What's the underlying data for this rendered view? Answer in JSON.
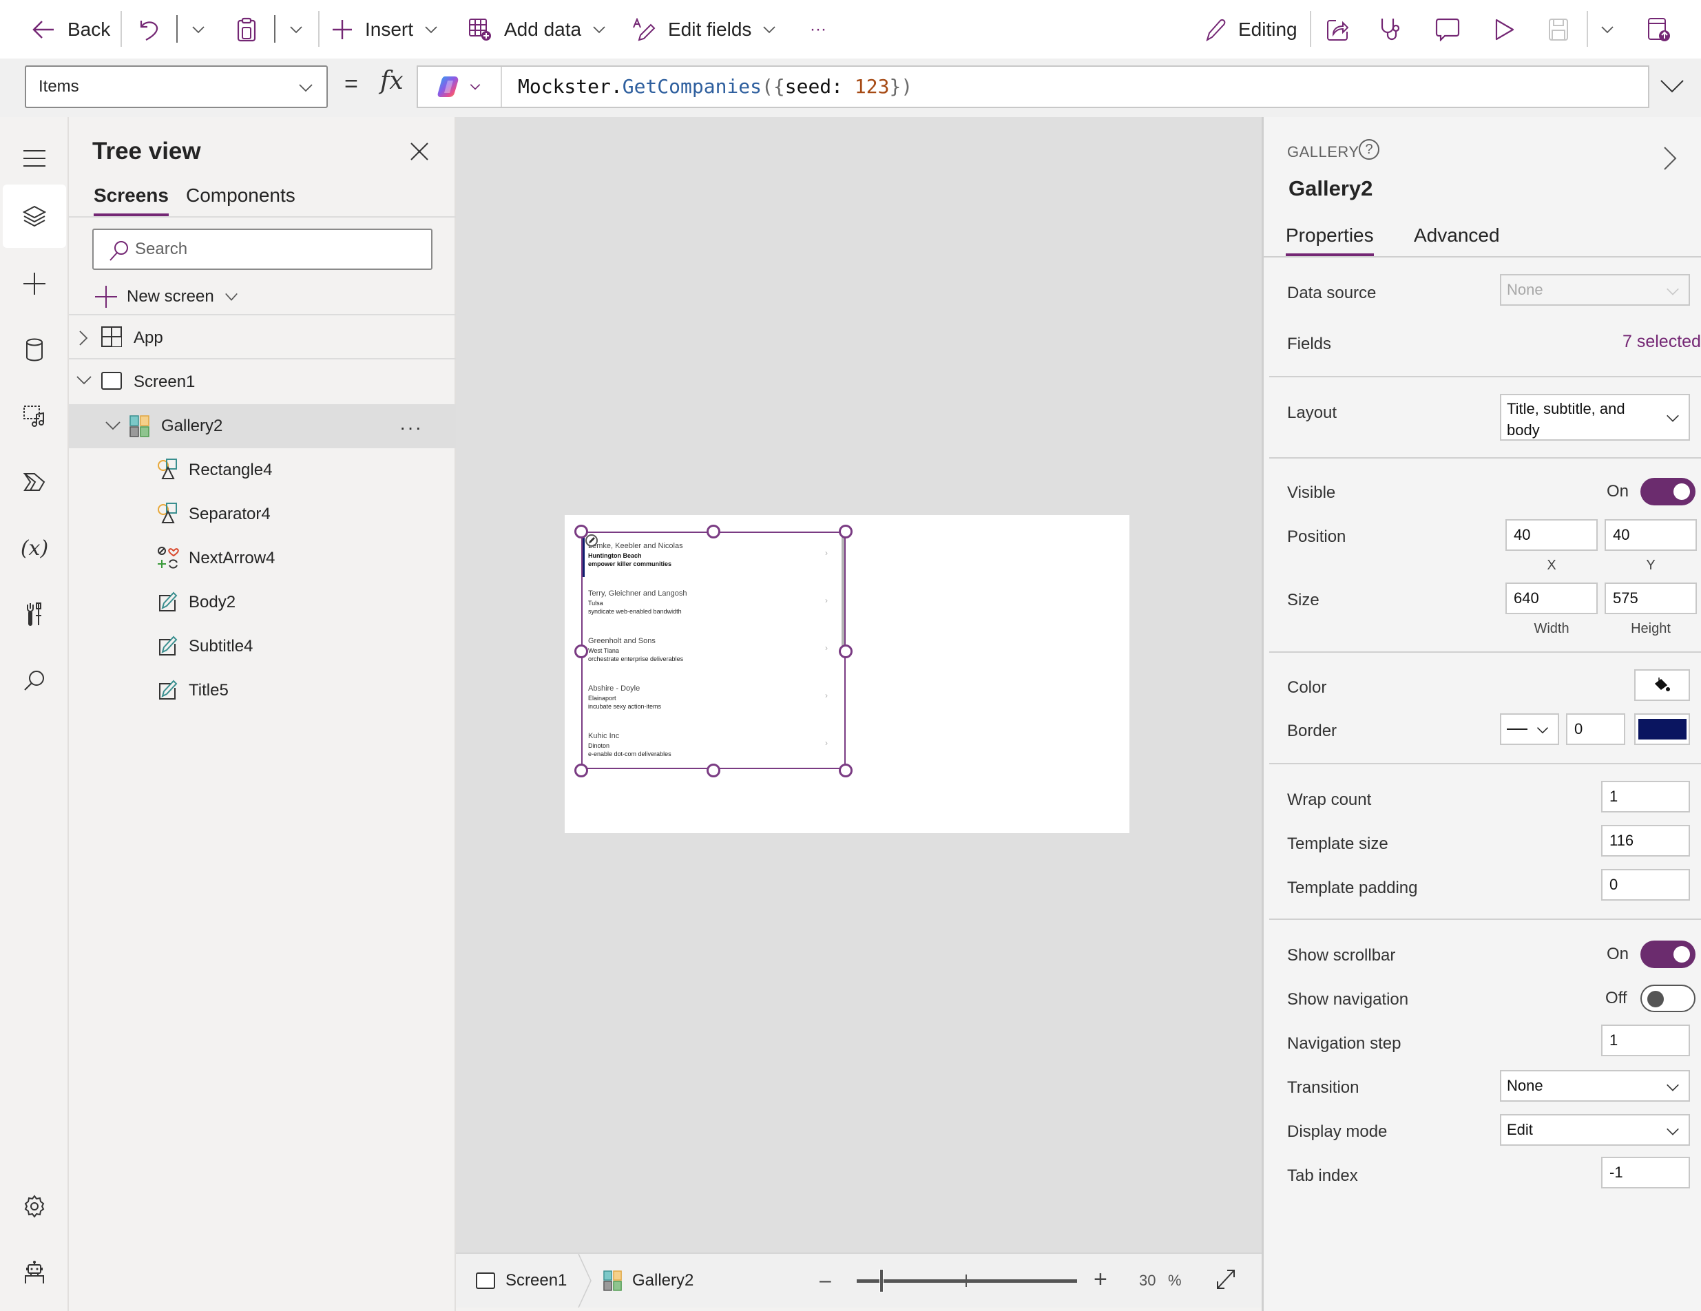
{
  "toolbar": {
    "back_label": "Back",
    "insert_label": "Insert",
    "add_data_label": "Add data",
    "edit_fields_label": "Edit fields",
    "more_label": "···",
    "mode_label": "Editing"
  },
  "formula_bar": {
    "property": "Items",
    "equals": "=",
    "fx": "fx",
    "formula": {
      "object": "Mockster.",
      "function": "GetCompanies",
      "open": "({",
      "key": "seed: ",
      "number": "123",
      "close": "})"
    }
  },
  "tree_view": {
    "title": "Tree view",
    "tabs": [
      {
        "label": "Screens",
        "active": true
      },
      {
        "label": "Components",
        "active": false
      }
    ],
    "search_placeholder": "Search",
    "new_screen_label": "New screen",
    "nodes": [
      {
        "label": "App",
        "icon": "app-icon",
        "expanded": false
      },
      {
        "label": "Screen1",
        "icon": "screen-icon",
        "expanded": true
      },
      {
        "label": "Gallery2",
        "icon": "gallery-icon",
        "expanded": true,
        "selected": true
      },
      {
        "label": "Rectangle4",
        "icon": "shapes-icon"
      },
      {
        "label": "Separator4",
        "icon": "shapes-icon"
      },
      {
        "label": "NextArrow4",
        "icon": "icons-control-icon"
      },
      {
        "label": "Body2",
        "icon": "label-edit-icon"
      },
      {
        "label": "Subtitle4",
        "icon": "label-edit-icon"
      },
      {
        "label": "Title5",
        "icon": "label-edit-icon"
      }
    ],
    "more_label": "···"
  },
  "gallery_items": [
    {
      "title": "Lemke, Keebler and Nicolas",
      "subtitle": "Huntington Beach",
      "body": "empower killer communities"
    },
    {
      "title": "Terry, Gleichner and Langosh",
      "subtitle": "Tulsa",
      "body": "syndicate web-enabled bandwidth"
    },
    {
      "title": "Greenholt and Sons",
      "subtitle": "West Tiana",
      "body": "orchestrate enterprise deliverables"
    },
    {
      "title": "Abshire - Doyle",
      "subtitle": "Elainaport",
      "body": "incubate sexy action-items"
    },
    {
      "title": "Kuhic Inc",
      "subtitle": "Dinoton",
      "body": "e-enable dot-com deliverables"
    }
  ],
  "status_bar": {
    "breadcrumb": [
      {
        "label": "Screen1",
        "icon": "screen-icon"
      },
      {
        "label": "Gallery2",
        "icon": "gallery-icon"
      }
    ],
    "zoom_value": "30",
    "zoom_unit": "%",
    "zoom_percent": 30
  },
  "properties": {
    "control_type": "GALLERY",
    "control_name": "Gallery2",
    "tabs": [
      {
        "label": "Properties",
        "active": true
      },
      {
        "label": "Advanced",
        "active": false
      }
    ],
    "data_source": {
      "label": "Data source",
      "value": "None"
    },
    "fields": {
      "label": "Fields",
      "value": "7 selected"
    },
    "layout": {
      "label": "Layout",
      "value": "Title, subtitle, and body"
    },
    "visible": {
      "label": "Visible",
      "state": "On",
      "on": true
    },
    "position": {
      "label": "Position",
      "x": "40",
      "y": "40",
      "x_caption": "X",
      "y_caption": "Y"
    },
    "size": {
      "label": "Size",
      "width": "640",
      "height": "575",
      "width_caption": "Width",
      "height_caption": "Height"
    },
    "color": {
      "label": "Color"
    },
    "border": {
      "label": "Border",
      "thickness": "0",
      "color": "#0a1560"
    },
    "wrap_count": {
      "label": "Wrap count",
      "value": "1"
    },
    "template_size": {
      "label": "Template size",
      "value": "116"
    },
    "template_padding": {
      "label": "Template padding",
      "value": "0"
    },
    "show_scrollbar": {
      "label": "Show scrollbar",
      "state": "On",
      "on": true
    },
    "show_navigation": {
      "label": "Show navigation",
      "state": "Off",
      "on": false
    },
    "navigation_step": {
      "label": "Navigation step",
      "value": "1"
    },
    "transition": {
      "label": "Transition",
      "value": "None"
    },
    "display_mode": {
      "label": "Display mode",
      "value": "Edit"
    },
    "tab_index": {
      "label": "Tab index",
      "value": "-1"
    }
  },
  "colors": {
    "accent": "#742774",
    "selection_handle": "#7a3b83",
    "border_color_swatch": "#0a1560"
  }
}
